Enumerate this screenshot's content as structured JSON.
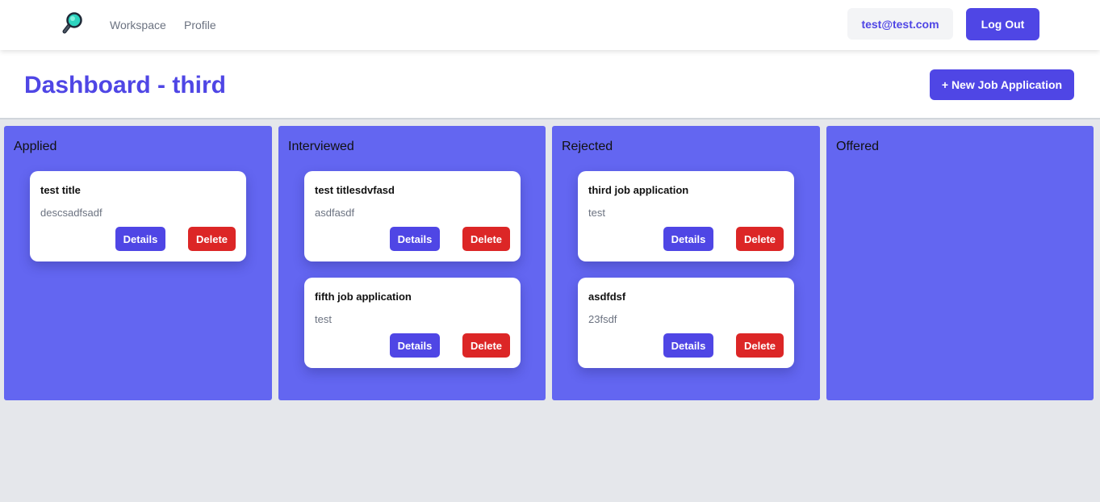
{
  "navbar": {
    "logo_icon": "magnifying-glass-icon",
    "links": {
      "workspace": "Workspace",
      "profile": "Profile"
    },
    "user_email": "test@test.com",
    "logout_label": "Log Out"
  },
  "header": {
    "title": "Dashboard - third",
    "new_button_label": "+ New Job Application"
  },
  "colors": {
    "accent": "#4f46e5",
    "column_bg": "#6366f1",
    "danger": "#dc2626",
    "page_bg": "#e5e7eb"
  },
  "columns": [
    {
      "title": "Applied",
      "cards": [
        {
          "title": "test title",
          "description": "descsadfsadf",
          "details_label": "Details",
          "delete_label": "Delete"
        }
      ]
    },
    {
      "title": "Interviewed",
      "cards": [
        {
          "title": "test titlesdvfasd",
          "description": "asdfasdf",
          "details_label": "Details",
          "delete_label": "Delete"
        },
        {
          "title": "fifth job application",
          "description": "test",
          "details_label": "Details",
          "delete_label": "Delete"
        }
      ]
    },
    {
      "title": "Rejected",
      "cards": [
        {
          "title": "third job application",
          "description": "test",
          "details_label": "Details",
          "delete_label": "Delete"
        },
        {
          "title": "asdfdsf",
          "description": "23fsdf",
          "details_label": "Details",
          "delete_label": "Delete"
        }
      ]
    },
    {
      "title": "Offered",
      "cards": []
    }
  ]
}
